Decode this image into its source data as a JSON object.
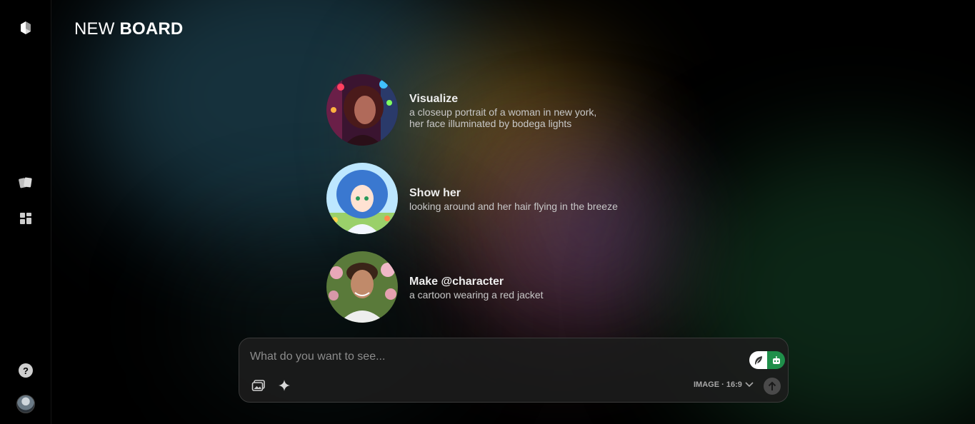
{
  "header": {
    "title_light": "NEW",
    "title_bold": "BOARD"
  },
  "sidebar": {
    "items": [
      {
        "name": "logo-icon"
      },
      {
        "name": "cards-icon"
      },
      {
        "name": "grid-icon"
      },
      {
        "name": "help-icon",
        "glyph": "?"
      },
      {
        "name": "avatar"
      }
    ]
  },
  "suggestions": [
    {
      "title": "Visualize",
      "description": "a closeup portrait of a woman in new york,\nher face illuminated by bodega lights"
    },
    {
      "title": "Show her",
      "description": "looking around and her hair flying in the breeze"
    },
    {
      "title": "Make @character",
      "description": "a cartoon wearing a red jacket"
    }
  ],
  "composer": {
    "placeholder": "What do you want to see...",
    "mode_label": "IMAGE · 16:9",
    "model_toggle": {
      "left_icon": "feather-icon",
      "right_icon": "robot-icon",
      "right_color": "#1f8f4a"
    }
  },
  "colors": {
    "background": "#000000",
    "accent_green": "#1f8f4a"
  }
}
